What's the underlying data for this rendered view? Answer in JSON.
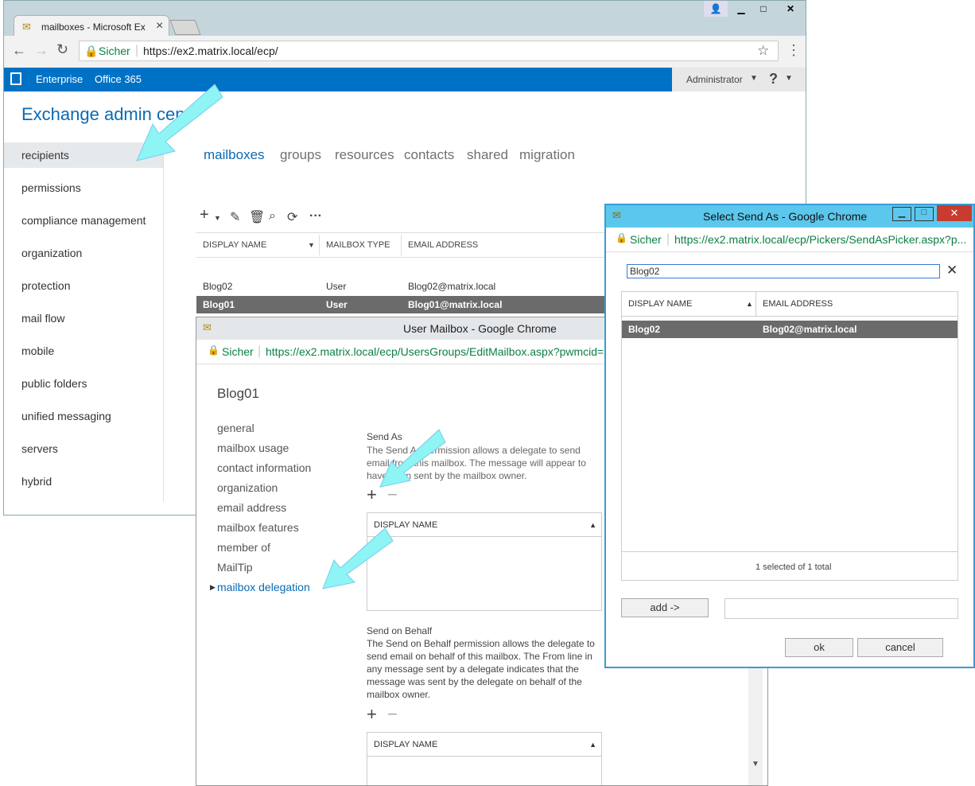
{
  "main_window": {
    "tab_title": "mailboxes - Microsoft Ex",
    "secure_label": "Sicher",
    "url": "https://ex2.matrix.local/ecp/",
    "nav_left": [
      "Enterprise",
      "Office 365"
    ],
    "admin_user": "Administrator",
    "help_label": "?",
    "app_title": "Exchange admin cen",
    "sidebar": [
      "recipients",
      "permissions",
      "compliance management",
      "organization",
      "protection",
      "mail flow",
      "mobile",
      "public folders",
      "unified messaging",
      "servers",
      "hybrid"
    ],
    "subtabs": [
      "mailboxes",
      "groups",
      "resources",
      "contacts",
      "shared",
      "migration"
    ],
    "columns": [
      "DISPLAY NAME",
      "MAILBOX TYPE",
      "EMAIL ADDRESS"
    ],
    "rows": [
      {
        "name": "Blog02",
        "type": "User",
        "email": "Blog02@matrix.local",
        "selected": false
      },
      {
        "name": "Blog01",
        "type": "User",
        "email": "Blog01@matrix.local",
        "selected": true
      }
    ]
  },
  "mailbox_window": {
    "title": "User Mailbox - Google Chrome",
    "secure_label": "Sicher",
    "url": "https://ex2.matrix.local/ecp/UsersGroups/EditMailbox.aspx?pwmcid=",
    "heading": "Blog01",
    "nav": [
      "general",
      "mailbox usage",
      "contact information",
      "organization",
      "email address",
      "mailbox features",
      "member of",
      "MailTip",
      "mailbox delegation"
    ],
    "send_as_title": "Send As",
    "send_as_desc": "The Send As permission allows a delegate to send email from this mailbox. The message will appear to have been sent by the mailbox owner.",
    "send_as_column": "DISPLAY NAME",
    "send_on_behalf_title": "Send on Behalf",
    "send_on_behalf_desc": "The Send on Behalf permission allows the delegate to send email on behalf of this mailbox. The From line in any message sent by a delegate indicates that the message was sent by the delegate on behalf of the mailbox owner.",
    "send_on_behalf_column": "DISPLAY NAME"
  },
  "picker_window": {
    "title": "Select Send As - Google Chrome",
    "secure_label": "Sicher",
    "url": "https://ex2.matrix.local/ecp/Pickers/SendAsPicker.aspx?p...",
    "search_value": "Blog02",
    "columns": [
      "DISPLAY NAME",
      "EMAIL ADDRESS"
    ],
    "rows": [
      {
        "name": "Blog02",
        "email": "Blog02@matrix.local"
      }
    ],
    "status": "1 selected of 1 total",
    "add_button": "add ->",
    "ok_button": "ok",
    "cancel_button": "cancel"
  },
  "colors": {
    "accent": "#0072c6",
    "link": "#0b6ab3",
    "selected_row": "#6b6b6b",
    "picker_frame": "#5cc7ec",
    "annotation_arrow": "#8ef4f4"
  }
}
